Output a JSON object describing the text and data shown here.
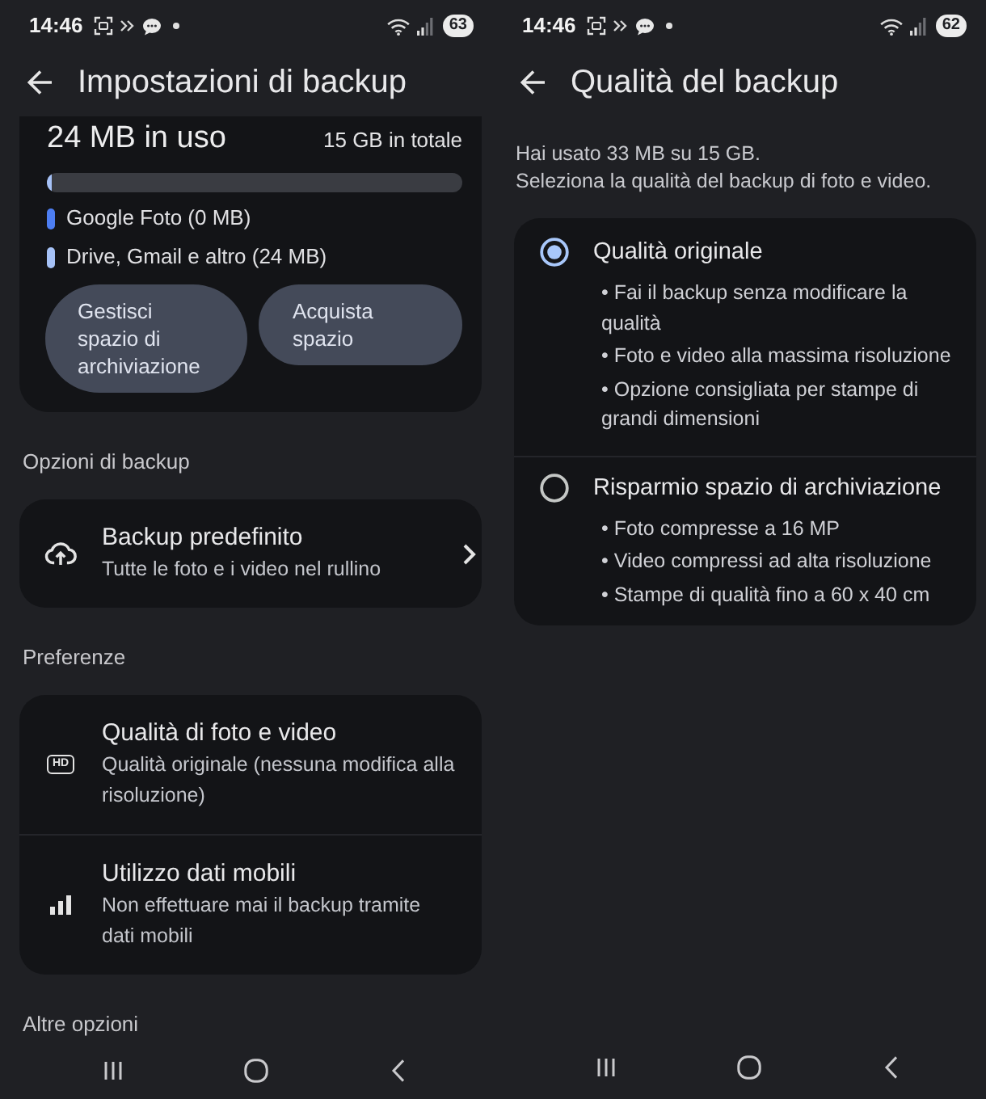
{
  "backup_settings": {
    "status_bar": {
      "time": "14:46",
      "battery": "63"
    },
    "title": "Impostazioni di backup",
    "storage": {
      "used": "24 MB in uso",
      "total": "15 GB in totale",
      "level": 0.01,
      "legend": [
        {
          "label": "Google Foto (0 MB)",
          "color": "#4d7ef2"
        },
        {
          "label": "Drive, Gmail e altro (24 MB)",
          "color": "#a6c2f7"
        }
      ],
      "buttons": [
        "Gestisci spazio di archiviazione",
        "Acquista spazio"
      ]
    },
    "sections": [
      {
        "heading": "Opzioni di backup",
        "items": [
          {
            "kind": "link",
            "title": "Backup predefinito",
            "subtitle": "Tutte le foto e i video nel rullino"
          }
        ]
      },
      {
        "heading": "Preferenze",
        "items": [
          {
            "kind": "setting",
            "title": "Qualità di foto e video",
            "subtitle": "Qualità originale (nessuna modifica alla risoluzione)",
            "icon_label": "HD"
          },
          {
            "kind": "setting",
            "title": "Utilizzo dati mobili",
            "subtitle": "Non effettuare mai il backup tramite dati mobili"
          }
        ]
      },
      {
        "heading": "Altre opzioni"
      }
    ]
  },
  "backup_quality": {
    "status_bar": {
      "time": "14:46",
      "battery": "62"
    },
    "title": "Qualità del backup",
    "intro": [
      "Hai usato 33 MB su 15 GB.",
      "Seleziona la qualità del backup di foto e video."
    ],
    "options": [
      {
        "title": "Qualità originale",
        "selected": true,
        "bullets": [
          "• Fai il backup senza modificare la qualità",
          "• Foto e video alla massima risoluzione",
          "• Opzione consigliata per stampe di grandi dimensioni"
        ]
      },
      {
        "title": "Risparmio spazio di archiviazione",
        "selected": false,
        "bullets": [
          "• Foto compresse a 16 MP",
          "• Video compressi ad alta risoluzione",
          "• Stampe di qualità fino a 60 x 40 cm"
        ]
      }
    ]
  }
}
